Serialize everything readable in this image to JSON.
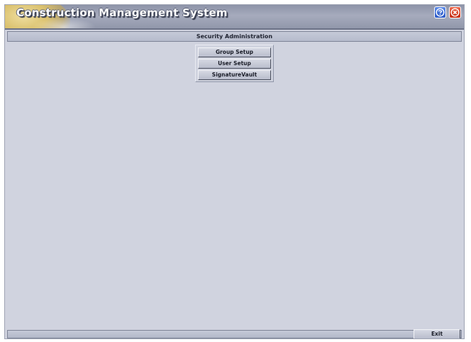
{
  "app": {
    "title": "Construction Management System"
  },
  "titlebar": {
    "help_icon": "help-icon",
    "close_icon": "close-icon"
  },
  "section": {
    "title": "Security Administration"
  },
  "menu": {
    "items": [
      {
        "label": "Group Setup"
      },
      {
        "label": "User Setup"
      },
      {
        "label": "SignatureVault"
      }
    ]
  },
  "footer": {
    "exit_label": "Exit"
  },
  "colors": {
    "background": "#d0d3df",
    "titlebar": "#a6abbd",
    "help_button": "#2b58c4",
    "close_button": "#c32a12"
  }
}
